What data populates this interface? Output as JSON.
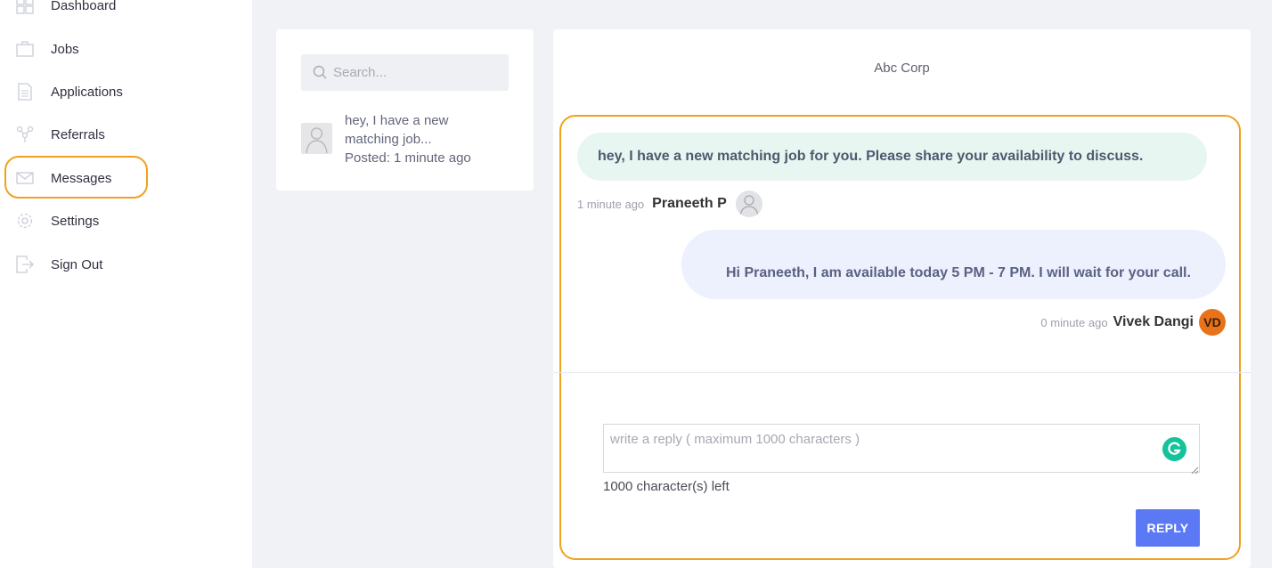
{
  "sidebar": {
    "items": [
      {
        "label": "Dashboard",
        "icon": "dashboard-icon"
      },
      {
        "label": "Jobs",
        "icon": "briefcase-icon"
      },
      {
        "label": "Applications",
        "icon": "document-icon"
      },
      {
        "label": "Referrals",
        "icon": "referral-icon"
      },
      {
        "label": "Messages",
        "icon": "envelope-icon"
      },
      {
        "label": "Settings",
        "icon": "gear-icon"
      },
      {
        "label": "Sign Out",
        "icon": "sign-out-icon"
      }
    ]
  },
  "conversations": {
    "search_placeholder": "Search...",
    "items": [
      {
        "preview_line1": "hey, I have a new",
        "preview_line2": "matching job...",
        "posted": "Posted: 1 minute ago"
      }
    ]
  },
  "chat": {
    "title": "Abc Corp",
    "messages": [
      {
        "text": "hey, I have a new matching job for you. Please share your availability to discuss.",
        "time": "1 minute ago",
        "sender": "Praneeth P"
      },
      {
        "text": "Hi Praneeth, I am available today 5 PM - 7 PM. I will wait for your call.",
        "time": "0 minute ago",
        "sender": "Vivek Dangi",
        "initials": "VD"
      }
    ],
    "reply_placeholder": "write a reply ( maximum 1000 characters )",
    "chars_left": "1000 character(s) left",
    "reply_label": "REPLY"
  },
  "colors": {
    "accent": "#5b79f5",
    "highlight": "#f0a21f",
    "incoming_bubble": "#e8f6f1",
    "outgoing_bubble": "#edf0fd",
    "avatar_vd": "#e8731a",
    "grammarly": "#15c39a"
  }
}
